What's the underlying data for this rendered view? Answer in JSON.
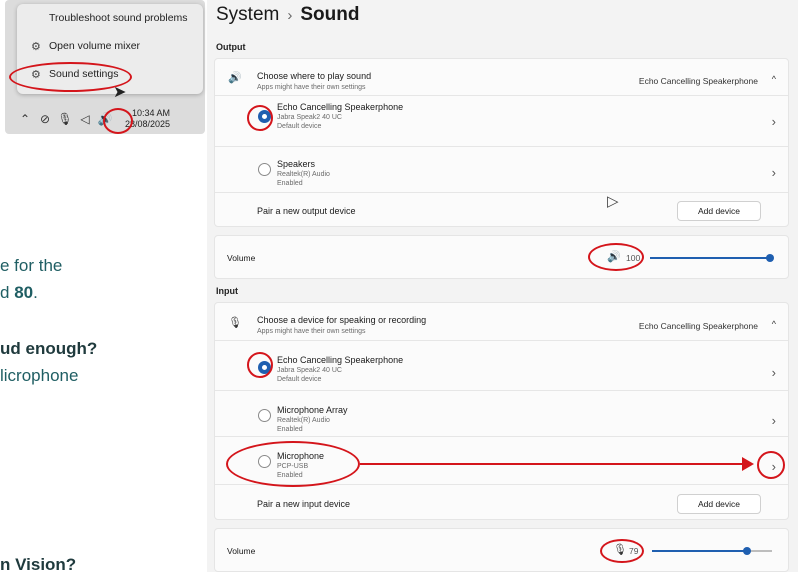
{
  "context_menu": {
    "items": [
      {
        "label": "Troubleshoot sound problems",
        "icon": "none"
      },
      {
        "label": "Open volume mixer",
        "icon": "gear-icon"
      },
      {
        "label": "Sound settings",
        "icon": "gear-icon"
      }
    ]
  },
  "taskbar": {
    "icons": [
      "chevron-up-icon",
      "network-off-icon",
      "microphone-icon",
      "location-icon",
      "speaker-icon"
    ],
    "time": "10:34 AM",
    "date": "28/08/2025"
  },
  "slide_text": {
    "line1": "e for the",
    "line2_prefix": "d ",
    "line2_bold": "80",
    "line2_suffix": ".",
    "line3": "ud enough?",
    "line4": "licrophone",
    "line5": "n Vision?"
  },
  "settings": {
    "breadcrumb_parent": "System",
    "breadcrumb_separator": "›",
    "breadcrumb_current": "Sound",
    "output": {
      "section_label": "Output",
      "header_title": "Choose where to play sound",
      "header_sub": "Apps might have their own settings",
      "selected_device": "Echo Cancelling Speakerphone",
      "devices": [
        {
          "name": "Echo Cancelling Speakerphone",
          "line2": "Jabra Speak2 40 UC",
          "line3": "Default device",
          "selected": true
        },
        {
          "name": "Speakers",
          "line2": "Realtek(R) Audio",
          "line3": "Enabled",
          "selected": false
        }
      ],
      "pair_label": "Pair a new output device",
      "add_button": "Add device",
      "volume_label": "Volume",
      "volume_value": "100",
      "volume_level": 1.0
    },
    "input": {
      "section_label": "Input",
      "header_title": "Choose a device for speaking or recording",
      "header_sub": "Apps might have their own settings",
      "selected_device": "Echo Cancelling Speakerphone",
      "devices": [
        {
          "name": "Echo Cancelling Speakerphone",
          "line2": "Jabra Speak2 40 UC",
          "line3": "Default device",
          "selected": true
        },
        {
          "name": "Microphone Array",
          "line2": "Realtek(R) Audio",
          "line3": "Enabled",
          "selected": false
        },
        {
          "name": "Microphone",
          "line2": "PCP-USB",
          "line3": "Enabled",
          "selected": false
        }
      ],
      "pair_label": "Pair a new input device",
      "add_button": "Add device",
      "volume_label": "Volume",
      "volume_value": "79",
      "volume_level": 0.79
    }
  },
  "colors": {
    "accent": "#1f5fb0",
    "annotation": "#d4151b",
    "slide_text": "#1f5e63"
  }
}
